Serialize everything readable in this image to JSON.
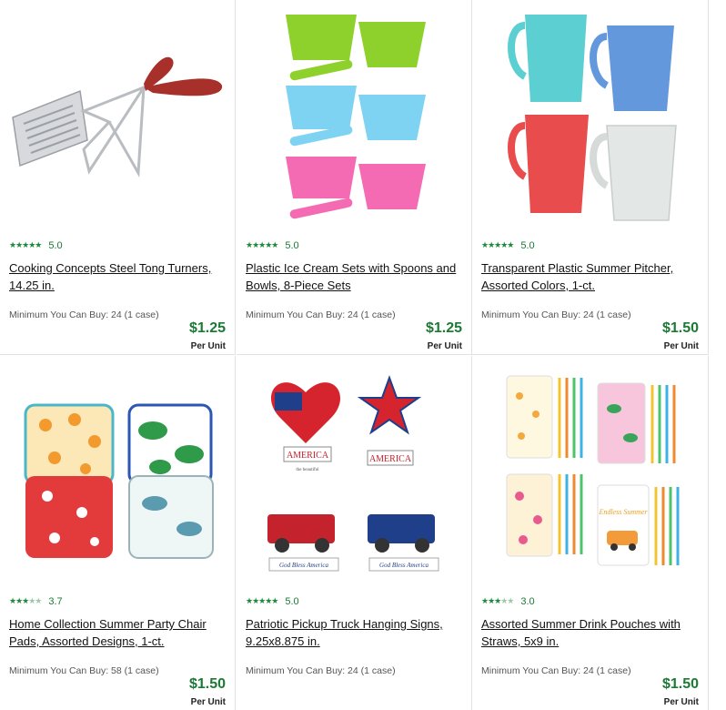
{
  "products": [
    {
      "rating": "5.0",
      "rating_value": 5.0,
      "title": "Cooking Concepts Steel Tong Turners, 14.25 in.",
      "minimum": "Minimum You Can Buy: 24 (1 case)",
      "price": "$1.25",
      "per_unit": "Per Unit"
    },
    {
      "rating": "5.0",
      "rating_value": 5.0,
      "title": "Plastic Ice Cream Sets with Spoons and Bowls, 8-Piece Sets",
      "minimum": "Minimum You Can Buy: 24 (1 case)",
      "price": "$1.25",
      "per_unit": "Per Unit"
    },
    {
      "rating": "5.0",
      "rating_value": 5.0,
      "title": "Transparent Plastic Summer Pitcher, Assorted Colors, 1-ct.",
      "minimum": "Minimum You Can Buy: 24 (1 case)",
      "price": "$1.50",
      "per_unit": "Per Unit"
    },
    {
      "rating": "3.7",
      "rating_value": 3.7,
      "title": "Home Collection Summer Party Chair Pads, Assorted Designs, 1-ct.",
      "minimum": "Minimum You Can Buy: 58 (1 case)",
      "price": "$1.50",
      "per_unit": "Per Unit"
    },
    {
      "rating": "5.0",
      "rating_value": 5.0,
      "title": "Patriotic Pickup Truck Hanging Signs, 9.25x8.875 in.",
      "minimum": "Minimum You Can Buy: 24 (1 case)",
      "price": "",
      "per_unit": ""
    },
    {
      "rating": "3.0",
      "rating_value": 3.0,
      "title": "Assorted Summer Drink Pouches with Straws, 5x9 in.",
      "minimum": "Minimum You Can Buy: 24 (1 case)",
      "price": "$1.50",
      "per_unit": "Per Unit"
    }
  ],
  "image_text": {
    "america_1": "AMERICA",
    "beautiful": "the beautiful",
    "america_2": "AMERICA",
    "god_bless_1": "God Bless America",
    "god_bless_2": "God Bless America",
    "endless_summer": "Endless Summer"
  },
  "colors": {
    "price_green": "#1b7a34",
    "star_green": "#1b8a3a",
    "divider": "#e2e2e2"
  }
}
